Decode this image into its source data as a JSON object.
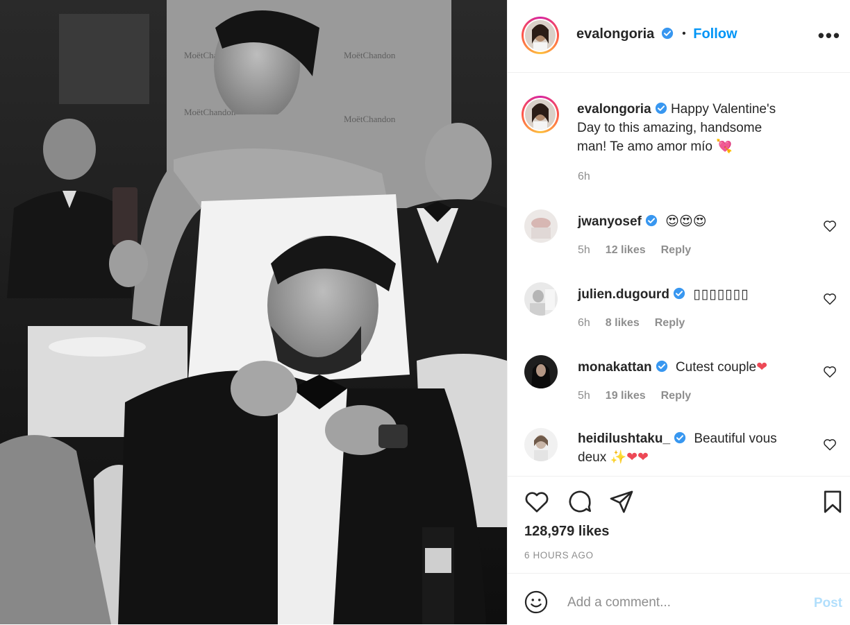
{
  "post": {
    "author": "evalongoria",
    "follow_label": "Follow",
    "more_label": "•••",
    "caption_text": "Happy Valentine's Day to this amazing, handsome man! Te amo amor mío",
    "caption_emoji": "💘",
    "caption_time": "6h"
  },
  "comments": [
    {
      "user": "jwanyosef",
      "text": "😍😍😍",
      "time": "5h",
      "likes": "12 likes",
      "reply": "Reply"
    },
    {
      "user": "julien.dugourd",
      "text": "▯▯▯▯▯▯▯",
      "time": "6h",
      "likes": "8 likes",
      "reply": "Reply"
    },
    {
      "user": "monakattan",
      "text": "Cutest couple",
      "emoji": "❤",
      "time": "5h",
      "likes": "19 likes",
      "reply": "Reply"
    },
    {
      "user": "heidilushtaku_",
      "text": "Beautiful vous deux",
      "emoji": "✨❤❤"
    }
  ],
  "stats": {
    "likes": "128,979 likes",
    "time_ago": "6 HOURS AGO"
  },
  "composer": {
    "placeholder": "Add a comment...",
    "post_label": "Post"
  },
  "icons": {
    "verified": "verified-badge-icon",
    "like": "heart-outline-icon",
    "comment": "speech-bubble-icon",
    "share": "paper-plane-icon",
    "save": "bookmark-icon",
    "emoji": "smiley-icon"
  },
  "colors": {
    "accent": "#0095f6",
    "heart_red": "#ed4956",
    "muted": "#8e8e8e",
    "text": "#262626",
    "post_disabled": "#b2dffc"
  }
}
